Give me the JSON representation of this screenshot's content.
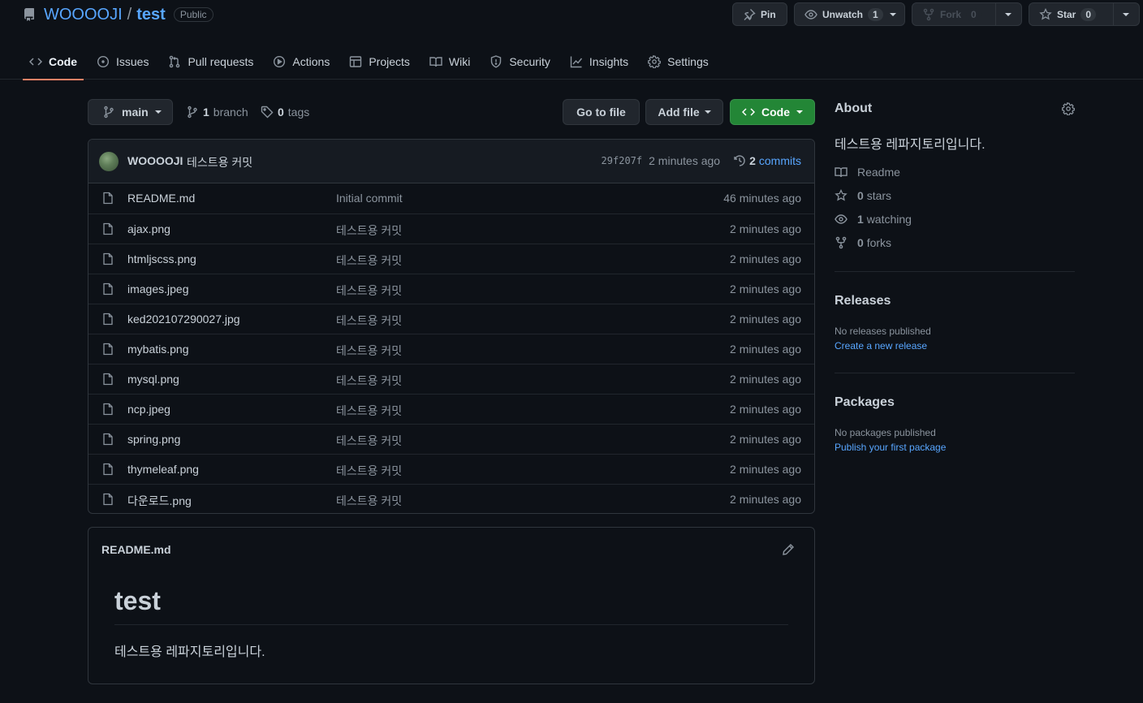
{
  "repo": {
    "owner": "WOOOOJI",
    "separator": "/",
    "name": "test",
    "visibility": "Public"
  },
  "header_actions": {
    "pin_label": "Pin",
    "unwatch_label": "Unwatch",
    "unwatch_count": "1",
    "fork_label": "Fork",
    "fork_count": "0",
    "star_label": "Star",
    "star_count": "0"
  },
  "nav": {
    "items": [
      {
        "label": "Code",
        "icon": "code-icon"
      },
      {
        "label": "Issues",
        "icon": "issue-icon"
      },
      {
        "label": "Pull requests",
        "icon": "pull-request-icon"
      },
      {
        "label": "Actions",
        "icon": "play-icon"
      },
      {
        "label": "Projects",
        "icon": "table-icon"
      },
      {
        "label": "Wiki",
        "icon": "book-icon"
      },
      {
        "label": "Security",
        "icon": "shield-icon"
      },
      {
        "label": "Insights",
        "icon": "graph-icon"
      },
      {
        "label": "Settings",
        "icon": "gear-icon"
      }
    ],
    "active": "Code"
  },
  "branch_bar": {
    "branch": "main",
    "branch_count": "1",
    "branch_word": "branch",
    "tag_count": "0",
    "tag_word": "tags",
    "go_to_file": "Go to file",
    "add_file": "Add file",
    "code": "Code"
  },
  "latest_commit": {
    "author": "WOOOOJI",
    "message": "테스트용 커밋",
    "sha": "29f207f",
    "age": "2 minutes ago",
    "commit_count": "2",
    "commit_word": "commits"
  },
  "files": [
    {
      "name": "README.md",
      "message": "Initial commit",
      "age": "46 minutes ago"
    },
    {
      "name": "ajax.png",
      "message": "테스트용 커밋",
      "age": "2 minutes ago"
    },
    {
      "name": "htmljscss.png",
      "message": "테스트용 커밋",
      "age": "2 minutes ago"
    },
    {
      "name": "images.jpeg",
      "message": "테스트용 커밋",
      "age": "2 minutes ago"
    },
    {
      "name": "ked202107290027.jpg",
      "message": "테스트용 커밋",
      "age": "2 minutes ago"
    },
    {
      "name": "mybatis.png",
      "message": "테스트용 커밋",
      "age": "2 minutes ago"
    },
    {
      "name": "mysql.png",
      "message": "테스트용 커밋",
      "age": "2 minutes ago"
    },
    {
      "name": "ncp.jpeg",
      "message": "테스트용 커밋",
      "age": "2 minutes ago"
    },
    {
      "name": "spring.png",
      "message": "테스트용 커밋",
      "age": "2 minutes ago"
    },
    {
      "name": "thymeleaf.png",
      "message": "테스트용 커밋",
      "age": "2 minutes ago"
    },
    {
      "name": "다운로드.png",
      "message": "테스트용 커밋",
      "age": "2 minutes ago"
    }
  ],
  "readme": {
    "filename": "README.md",
    "title": "test",
    "body": "테스트용 레파지토리입니다."
  },
  "about": {
    "title": "About",
    "description": "테스트용 레파지토리입니다.",
    "readme": "Readme",
    "stars_count": "0",
    "stars_word": "stars",
    "watching_count": "1",
    "watching_word": "watching",
    "forks_count": "0",
    "forks_word": "forks"
  },
  "releases": {
    "title": "Releases",
    "empty": "No releases published",
    "link": "Create a new release"
  },
  "packages": {
    "title": "Packages",
    "empty": "No packages published",
    "link": "Publish your first package"
  },
  "colors": {
    "background": "#0d1117",
    "link": "#58a6ff",
    "green_button": "#238636",
    "active_tab_underline": "#f78166"
  }
}
